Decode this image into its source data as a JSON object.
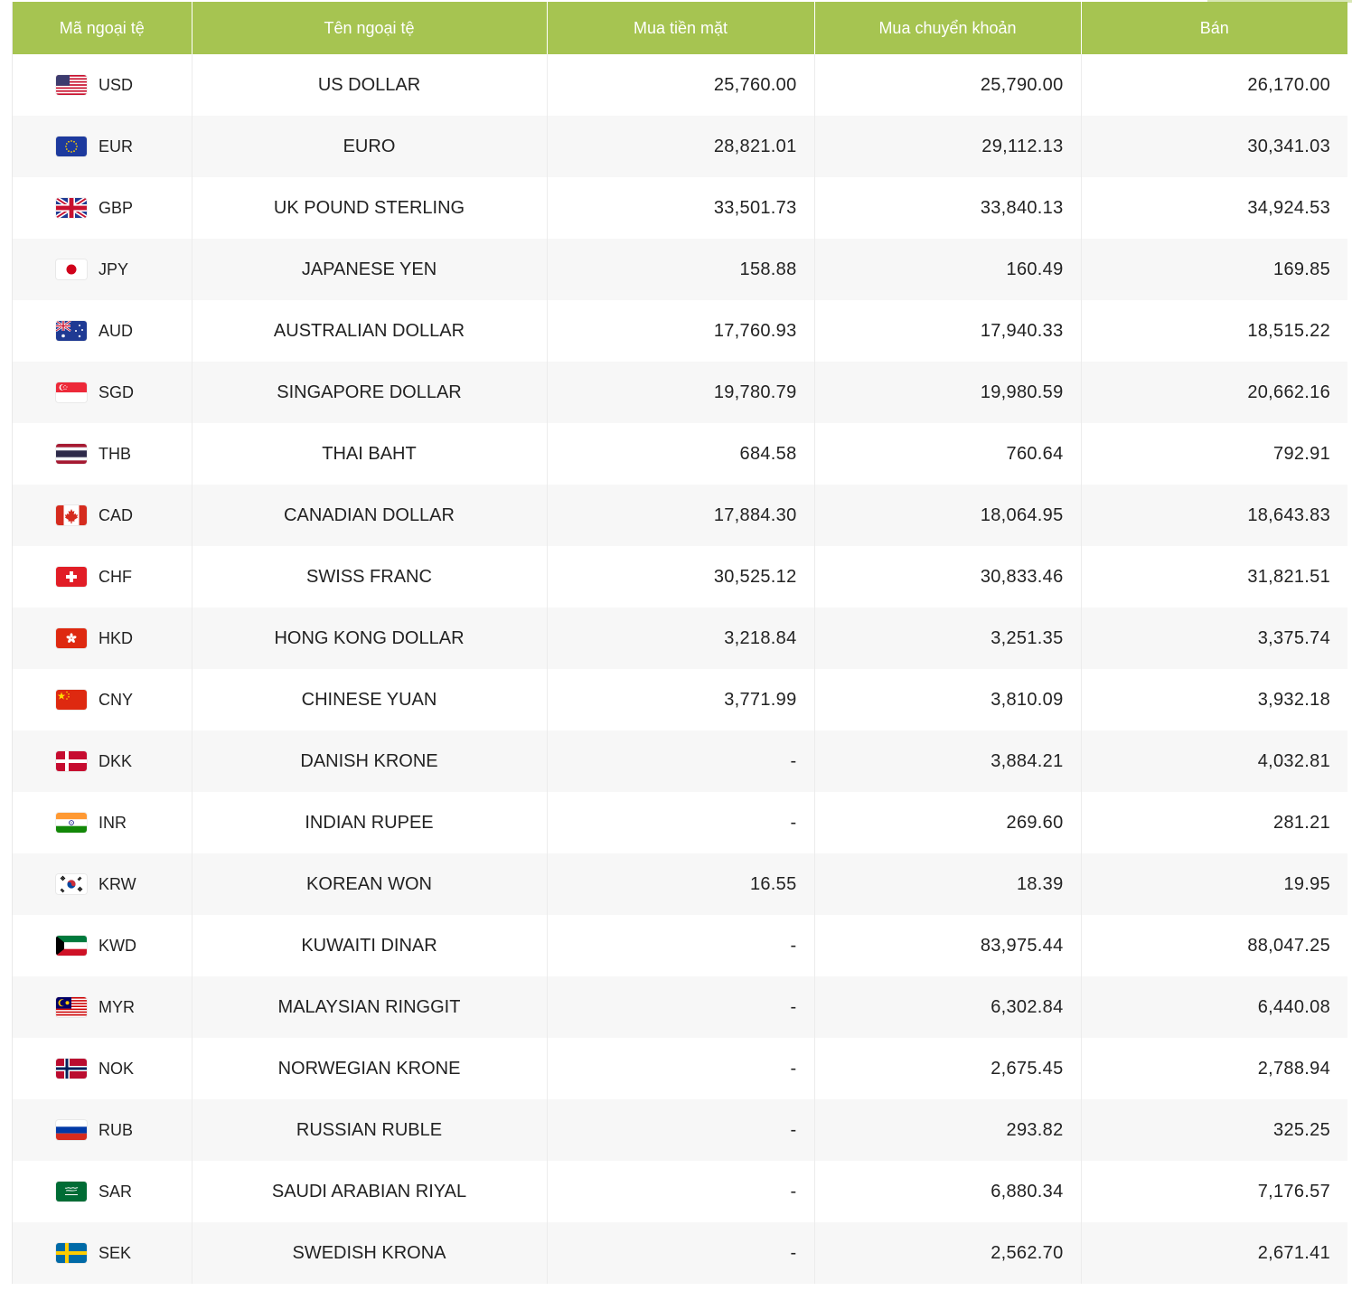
{
  "table": {
    "headers": [
      "Mã ngoại tệ",
      "Tên ngoại tệ",
      "Mua tiền mặt",
      "Mua chuyển khoản",
      "Bán"
    ],
    "rows": [
      {
        "code": "USD",
        "name": "US DOLLAR",
        "cash_buy": "25,760.00",
        "transfer_buy": "25,790.00",
        "sell": "26,170.00",
        "flag_icon": "us-flag-icon"
      },
      {
        "code": "EUR",
        "name": "EURO",
        "cash_buy": "28,821.01",
        "transfer_buy": "29,112.13",
        "sell": "30,341.03",
        "flag_icon": "eu-flag-icon"
      },
      {
        "code": "GBP",
        "name": "UK POUND STERLING",
        "cash_buy": "33,501.73",
        "transfer_buy": "33,840.13",
        "sell": "34,924.53",
        "flag_icon": "uk-flag-icon"
      },
      {
        "code": "JPY",
        "name": "JAPANESE YEN",
        "cash_buy": "158.88",
        "transfer_buy": "160.49",
        "sell": "169.85",
        "flag_icon": "japan-flag-icon"
      },
      {
        "code": "AUD",
        "name": "AUSTRALIAN DOLLAR",
        "cash_buy": "17,760.93",
        "transfer_buy": "17,940.33",
        "sell": "18,515.22",
        "flag_icon": "australia-flag-icon"
      },
      {
        "code": "SGD",
        "name": "SINGAPORE DOLLAR",
        "cash_buy": "19,780.79",
        "transfer_buy": "19,980.59",
        "sell": "20,662.16",
        "flag_icon": "singapore-flag-icon"
      },
      {
        "code": "THB",
        "name": "THAI BAHT",
        "cash_buy": "684.58",
        "transfer_buy": "760.64",
        "sell": "792.91",
        "flag_icon": "thailand-flag-icon"
      },
      {
        "code": "CAD",
        "name": "CANADIAN DOLLAR",
        "cash_buy": "17,884.30",
        "transfer_buy": "18,064.95",
        "sell": "18,643.83",
        "flag_icon": "canada-flag-icon"
      },
      {
        "code": "CHF",
        "name": "SWISS FRANC",
        "cash_buy": "30,525.12",
        "transfer_buy": "30,833.46",
        "sell": "31,821.51",
        "flag_icon": "switzerland-flag-icon"
      },
      {
        "code": "HKD",
        "name": "HONG KONG DOLLAR",
        "cash_buy": "3,218.84",
        "transfer_buy": "3,251.35",
        "sell": "3,375.74",
        "flag_icon": "hong-kong-flag-icon"
      },
      {
        "code": "CNY",
        "name": "CHINESE YUAN",
        "cash_buy": "3,771.99",
        "transfer_buy": "3,810.09",
        "sell": "3,932.18",
        "flag_icon": "china-flag-icon"
      },
      {
        "code": "DKK",
        "name": "DANISH KRONE",
        "cash_buy": "-",
        "transfer_buy": "3,884.21",
        "sell": "4,032.81",
        "flag_icon": "denmark-flag-icon"
      },
      {
        "code": "INR",
        "name": "INDIAN RUPEE",
        "cash_buy": "-",
        "transfer_buy": "269.60",
        "sell": "281.21",
        "flag_icon": "india-flag-icon"
      },
      {
        "code": "KRW",
        "name": "KOREAN WON",
        "cash_buy": "16.55",
        "transfer_buy": "18.39",
        "sell": "19.95",
        "flag_icon": "korea-flag-icon"
      },
      {
        "code": "KWD",
        "name": "KUWAITI DINAR",
        "cash_buy": "-",
        "transfer_buy": "83,975.44",
        "sell": "88,047.25",
        "flag_icon": "kuwait-flag-icon"
      },
      {
        "code": "MYR",
        "name": "MALAYSIAN RINGGIT",
        "cash_buy": "-",
        "transfer_buy": "6,302.84",
        "sell": "6,440.08",
        "flag_icon": "malaysia-flag-icon"
      },
      {
        "code": "NOK",
        "name": "NORWEGIAN KRONE",
        "cash_buy": "-",
        "transfer_buy": "2,675.45",
        "sell": "2,788.94",
        "flag_icon": "norway-flag-icon"
      },
      {
        "code": "RUB",
        "name": "RUSSIAN RUBLE",
        "cash_buy": "-",
        "transfer_buy": "293.82",
        "sell": "325.25",
        "flag_icon": "russia-flag-icon"
      },
      {
        "code": "SAR",
        "name": "SAUDI ARABIAN RIYAL",
        "cash_buy": "-",
        "transfer_buy": "6,880.34",
        "sell": "7,176.57",
        "flag_icon": "saudi-arabia-flag-icon"
      },
      {
        "code": "SEK",
        "name": "SWEDISH KRONA",
        "cash_buy": "-",
        "transfer_buy": "2,562.70",
        "sell": "2,671.41",
        "flag_icon": "sweden-flag-icon"
      }
    ]
  },
  "colors": {
    "header_bg": "#a6c451",
    "header_text": "#ffffff",
    "row_alt_bg": "#f7f7f7",
    "text": "#222222"
  }
}
